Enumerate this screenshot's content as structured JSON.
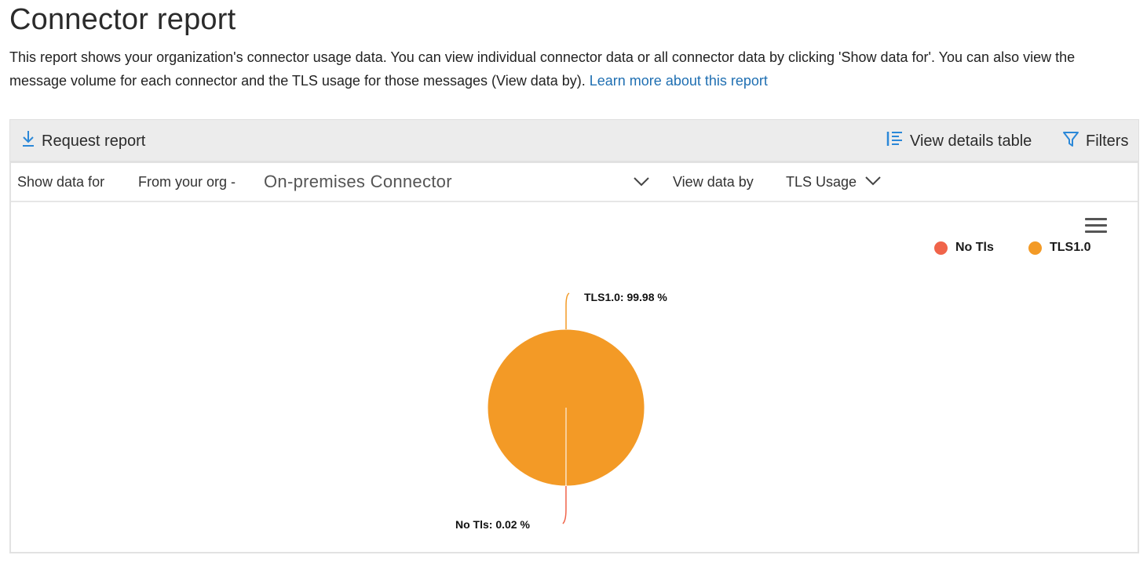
{
  "page": {
    "title": "Connector report",
    "description": "This report shows your organization's connector usage data. You can view individual connector data or all connector data by clicking 'Show data for'. You can also view the message volume for each connector and the TLS usage for those messages (View data by).",
    "learn_more": "Learn more about this report"
  },
  "toolbar": {
    "request_report": "Request report",
    "view_details_table": "View details table",
    "filters": "Filters",
    "icons": {
      "request": "download-icon",
      "details": "list-icon",
      "filters": "filter-icon"
    },
    "accent": "#2b88d8"
  },
  "filter_row": {
    "show_data_for_label": "Show data for",
    "org_value": "From your org -",
    "connector_value": "On-premises Connector",
    "view_data_by_label": "View data by",
    "view_data_by_value": "TLS Usage"
  },
  "chart_data": {
    "type": "pie",
    "series": [
      {
        "name": "No Tls",
        "value": 0.02,
        "color": "#f0644a",
        "label": "No Tls: 0.02 %"
      },
      {
        "name": "TLS1.0",
        "value": 99.98,
        "color": "#f39a26",
        "label": "TLS1.0: 99.98 %"
      }
    ],
    "legend_position": "top-right"
  }
}
